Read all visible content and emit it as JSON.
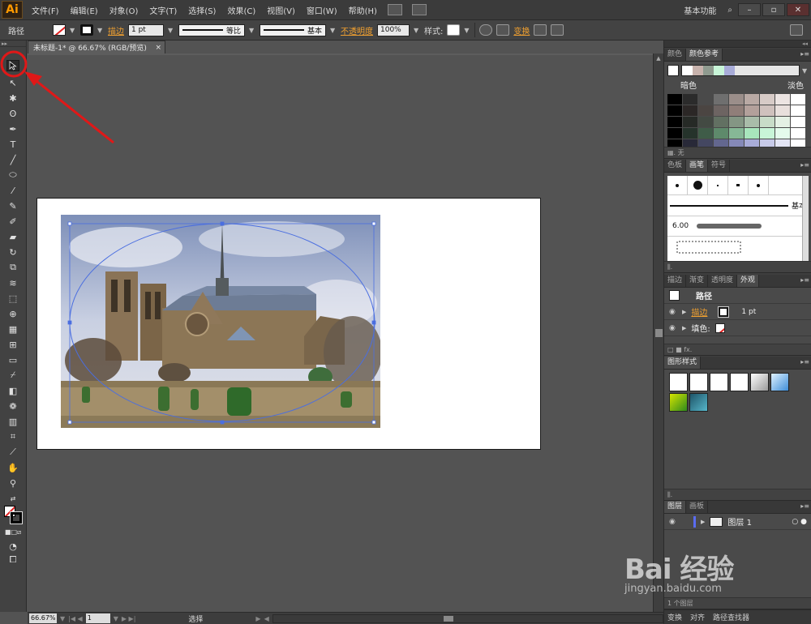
{
  "app": {
    "logo": "Ai",
    "menus": [
      "文件(F)",
      "编辑(E)",
      "对象(O)",
      "文字(T)",
      "选择(S)",
      "效果(C)",
      "视图(V)",
      "窗口(W)",
      "帮助(H)"
    ],
    "workspace": "基本功能",
    "colors": {
      "accent_link": "#f0a030",
      "logo_fg": "#ff9a00",
      "annotation_red": "#e01818",
      "selection_blue": "#4a6ee0"
    }
  },
  "control_bar": {
    "object_type": "路径",
    "stroke_label": "描边",
    "stroke_weight": "1 pt",
    "profile_label": "等比",
    "brush_label": "基本",
    "opacity_label": "不透明度",
    "opacity_value": "100%",
    "style_label": "样式:",
    "transform_label": "变换"
  },
  "document": {
    "tab_title": "未标题-1* @ 66.67% (RGB/预览)",
    "close_glyph": "×"
  },
  "status_bar": {
    "zoom": "66.67%",
    "page": "1",
    "status_text": "选择"
  },
  "panels": {
    "color_group": {
      "tabs": [
        "颜色",
        "颜色参考"
      ],
      "active_tab": "颜色参考",
      "left_label": "暗色",
      "right_label": "淡色",
      "footer_label": "无",
      "harmony_strip": [
        "#ffffff",
        "#c7b2ac",
        "#8f9a8f",
        "#c8f5d8",
        "#a8acd8"
      ],
      "grid_colors": [
        [
          "#000000",
          "#2b2b2b",
          "#4a4a4a",
          "#6f6f6f",
          "#9b8e8a",
          "#b9a9a4",
          "#d7cbc7",
          "#ece4e2",
          "#ffffff"
        ],
        [
          "#000000",
          "#2b2726",
          "#4b4542",
          "#6d6462",
          "#907e79",
          "#b3a09b",
          "#cfc1bd",
          "#e8dfdc",
          "#ffffff"
        ],
        [
          "#000000",
          "#262a26",
          "#434a43",
          "#627062",
          "#849684",
          "#a9bca9",
          "#c8dcc8",
          "#e4f0e4",
          "#ffffff"
        ],
        [
          "#000000",
          "#25332b",
          "#3f5c48",
          "#5e8a6b",
          "#86b896",
          "#a8e6bc",
          "#c8f5d8",
          "#e4fbec",
          "#ffffff"
        ],
        [
          "#000000",
          "#282938",
          "#444761",
          "#63678f",
          "#8589b8",
          "#a8acd8",
          "#c7cae8",
          "#e3e5f4",
          "#ffffff"
        ]
      ]
    },
    "brush_group": {
      "tabs": [
        "色板",
        "画笔",
        "符号"
      ],
      "active_tab": "画笔",
      "basic_label": "基本",
      "size_label": "6.00"
    },
    "appearance_group": {
      "tabs": [
        "描边",
        "渐变",
        "透明度",
        "外观"
      ],
      "active_tab": "外观",
      "title": "路径",
      "stroke_label": "描边",
      "stroke_value": "1 pt",
      "fill_label": "填色:"
    },
    "graphic_styles": {
      "tabs": [
        "图形样式"
      ],
      "active_tab": "图形样式"
    },
    "layers": {
      "tabs": [
        "图层",
        "画板"
      ],
      "active_tab": "图层",
      "layer_name": "图层 1",
      "footer_label": "1 个图层"
    },
    "bottom_tabs": [
      "变换",
      "对齐",
      "路径查找器"
    ]
  },
  "watermark": {
    "brand": "Bai 经验",
    "url": "jingyan.baidu.com"
  }
}
